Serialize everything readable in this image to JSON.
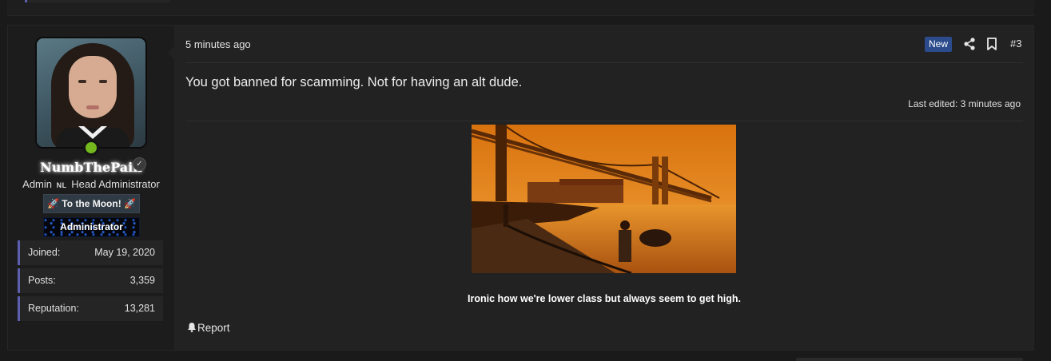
{
  "post": {
    "number": "#3",
    "timestamp": "5 minutes ago",
    "new_badge": "New",
    "message": "You got banned for scamming. Not for having an alt dude.",
    "last_edited": "Last edited: 3 minutes ago",
    "signature": "Ironic how we're lower class but always seem to get high.",
    "report_label": "Report"
  },
  "user": {
    "name": "NumbThePain",
    "title_prefix": "Admin",
    "title_flag": "NL",
    "title_suffix": "Head Administrator",
    "banner_moon": "🚀 To the Moon! 🚀",
    "banner_admin": "Administrator",
    "status": "online",
    "stats": [
      {
        "label": "Joined:",
        "value": "May 19, 2020"
      },
      {
        "label": "Posts:",
        "value": "3,359"
      },
      {
        "label": "Reputation:",
        "value": "13,281"
      }
    ]
  },
  "icons": {
    "share": "share-icon",
    "bookmark": "bookmark-icon",
    "bell": "bell-icon",
    "verified": "verified-icon"
  },
  "colors": {
    "background": "#1a1a1a",
    "post_bg": "#222222",
    "user_col_bg": "#1c1c1c",
    "accent": "#5e5eb0",
    "new_badge": "#2b4b8c",
    "online": "#74b81e"
  }
}
